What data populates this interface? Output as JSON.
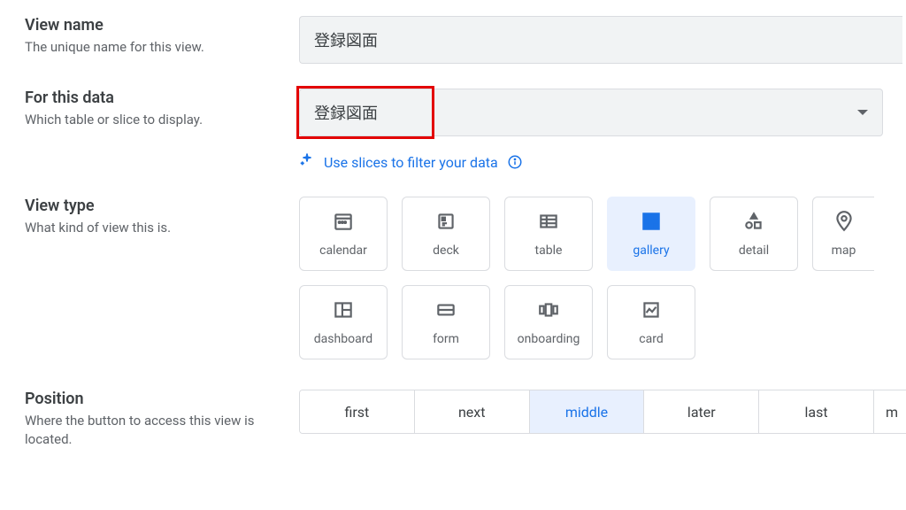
{
  "view_name": {
    "title": "View name",
    "desc": "The unique name for this view.",
    "value": "登録図面"
  },
  "for_data": {
    "title": "For this data",
    "desc": "Which table or slice to display.",
    "value": "登録図面",
    "hint_text": "Use slices to filter your data"
  },
  "view_type": {
    "title": "View type",
    "desc": "What kind of view this is.",
    "selected": "gallery",
    "tiles": [
      {
        "id": "calendar",
        "label": "calendar"
      },
      {
        "id": "deck",
        "label": "deck"
      },
      {
        "id": "table",
        "label": "table"
      },
      {
        "id": "gallery",
        "label": "gallery"
      },
      {
        "id": "detail",
        "label": "detail"
      },
      {
        "id": "map",
        "label": "map"
      },
      {
        "id": "dashboard",
        "label": "dashboard"
      },
      {
        "id": "form",
        "label": "form"
      },
      {
        "id": "onboarding",
        "label": "onboarding"
      },
      {
        "id": "card",
        "label": "card"
      }
    ]
  },
  "position": {
    "title": "Position",
    "desc": "Where the button to access this view is located.",
    "selected": "middle",
    "options": [
      "first",
      "next",
      "middle",
      "later",
      "last",
      "m"
    ]
  }
}
